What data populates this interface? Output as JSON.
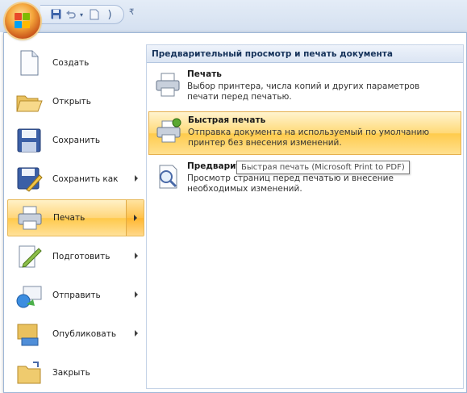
{
  "qat": {
    "more": "₹"
  },
  "menu": {
    "left": [
      {
        "id": "create",
        "label": "Создать",
        "icon": "new-document-icon",
        "submenu": false,
        "active": false
      },
      {
        "id": "open",
        "label": "Открыть",
        "icon": "open-folder-icon",
        "submenu": false,
        "active": false
      },
      {
        "id": "save",
        "label": "Сохранить",
        "icon": "save-floppy-icon",
        "submenu": false,
        "active": false
      },
      {
        "id": "save-as",
        "label": "Сохранить как",
        "icon": "save-as-icon",
        "submenu": true,
        "active": false
      },
      {
        "id": "print",
        "label": "Печать",
        "icon": "printer-icon",
        "submenu": true,
        "active": true
      },
      {
        "id": "prepare",
        "label": "Подготовить",
        "icon": "prepare-pen-icon",
        "submenu": true,
        "active": false
      },
      {
        "id": "send",
        "label": "Отправить",
        "icon": "send-icon",
        "submenu": true,
        "active": false
      },
      {
        "id": "publish",
        "label": "Опубликовать",
        "icon": "publish-icon",
        "submenu": true,
        "active": false
      },
      {
        "id": "close",
        "label": "Закрыть",
        "icon": "close-folder-icon",
        "submenu": false,
        "active": false
      }
    ],
    "right": {
      "title": "Предварительный просмотр и печать документа",
      "items": [
        {
          "id": "print",
          "title": "Печать",
          "description": "Выбор принтера, числа копий и других параметров печати перед печатью.",
          "icon": "printer-icon",
          "hover": false
        },
        {
          "id": "quick-print",
          "title": "Быстрая печать",
          "description": "Отправка документа на используемый по умолчанию принтер без внесения изменений.",
          "icon": "quick-print-icon",
          "hover": true
        },
        {
          "id": "preview",
          "title": "Предварит",
          "description": "Просмотр страниц перед печатью и внесение необходимых изменений.",
          "icon": "print-preview-icon",
          "hover": false
        }
      ]
    },
    "tooltip": "Быстрая печать (Microsoft Print to PDF)"
  },
  "colors": {
    "highlight": "#ffd67a",
    "pane_border": "#9fb7d7",
    "title_text": "#15325a"
  }
}
